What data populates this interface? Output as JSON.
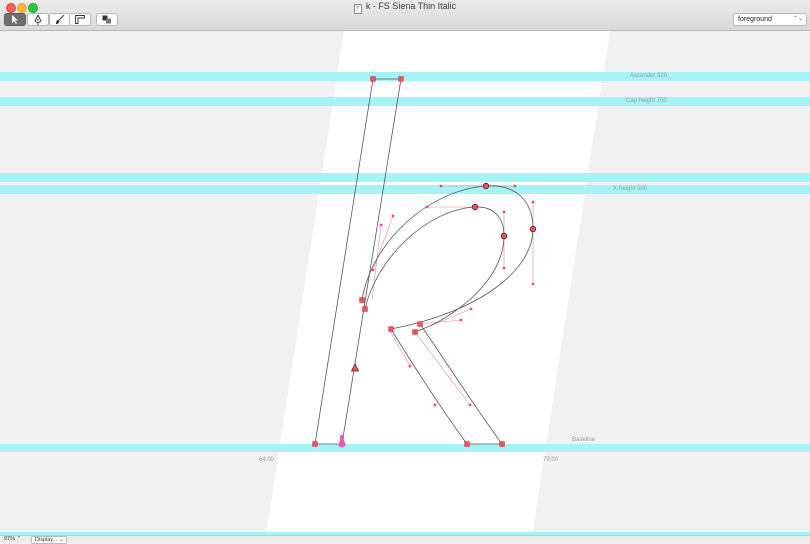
{
  "window": {
    "title": "k - FS Siena Thin Italic",
    "doc_icon_glyph": "T"
  },
  "toolbar": {
    "tools": [
      {
        "name": "select-tool",
        "icon": "arrow-pointer-icon",
        "active": true
      },
      {
        "name": "pen-tool",
        "icon": "pen-nib-icon",
        "active": false
      },
      {
        "name": "brush-tool",
        "icon": "brush-icon",
        "active": false
      },
      {
        "name": "ruler-tool",
        "icon": "ruler-icon",
        "active": false
      },
      {
        "name": "shapes-tool",
        "icon": "shapes-icon",
        "active": false
      }
    ],
    "layer_value": "foreground",
    "layer_arrows": "⌃⌄"
  },
  "guides": {
    "ascender_label": "Ascender 820",
    "cap_height_label": "Cap height 700",
    "x_height_label": "X-height 500",
    "baseline_label": "Baseline",
    "left_sidebearing": "64.00",
    "right_sidebearing": "79.00"
  },
  "status": {
    "zoom": "97%",
    "zoom_arrows": "⌃",
    "display_label": "Display...",
    "display_arrow": "⌄"
  },
  "colors": {
    "guide": "#a6f2f5",
    "point": "#f0515f",
    "outline": "#555555",
    "glyph_area": "#ffffff",
    "background": "#f1f1f1"
  }
}
